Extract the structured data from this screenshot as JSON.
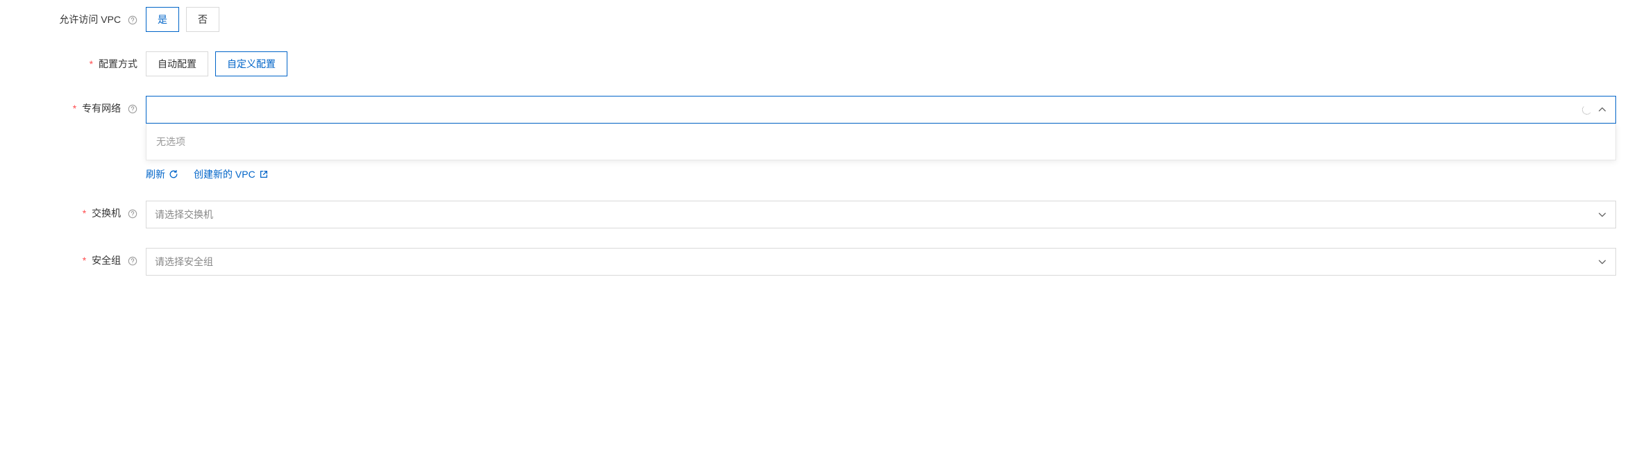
{
  "fields": {
    "allowVpc": {
      "label": "允许访问 VPC",
      "options": {
        "yes": "是",
        "no": "否"
      }
    },
    "configMode": {
      "label": "配置方式",
      "options": {
        "auto": "自动配置",
        "custom": "自定义配置"
      }
    },
    "vpc": {
      "label": "专有网络",
      "dropdownEmpty": "无选项",
      "links": {
        "refresh": "刷新",
        "create": "创建新的 VPC"
      }
    },
    "vswitch": {
      "label": "交换机",
      "placeholder": "请选择交换机"
    },
    "securityGroup": {
      "label": "安全组",
      "placeholder": "请选择安全组"
    }
  }
}
